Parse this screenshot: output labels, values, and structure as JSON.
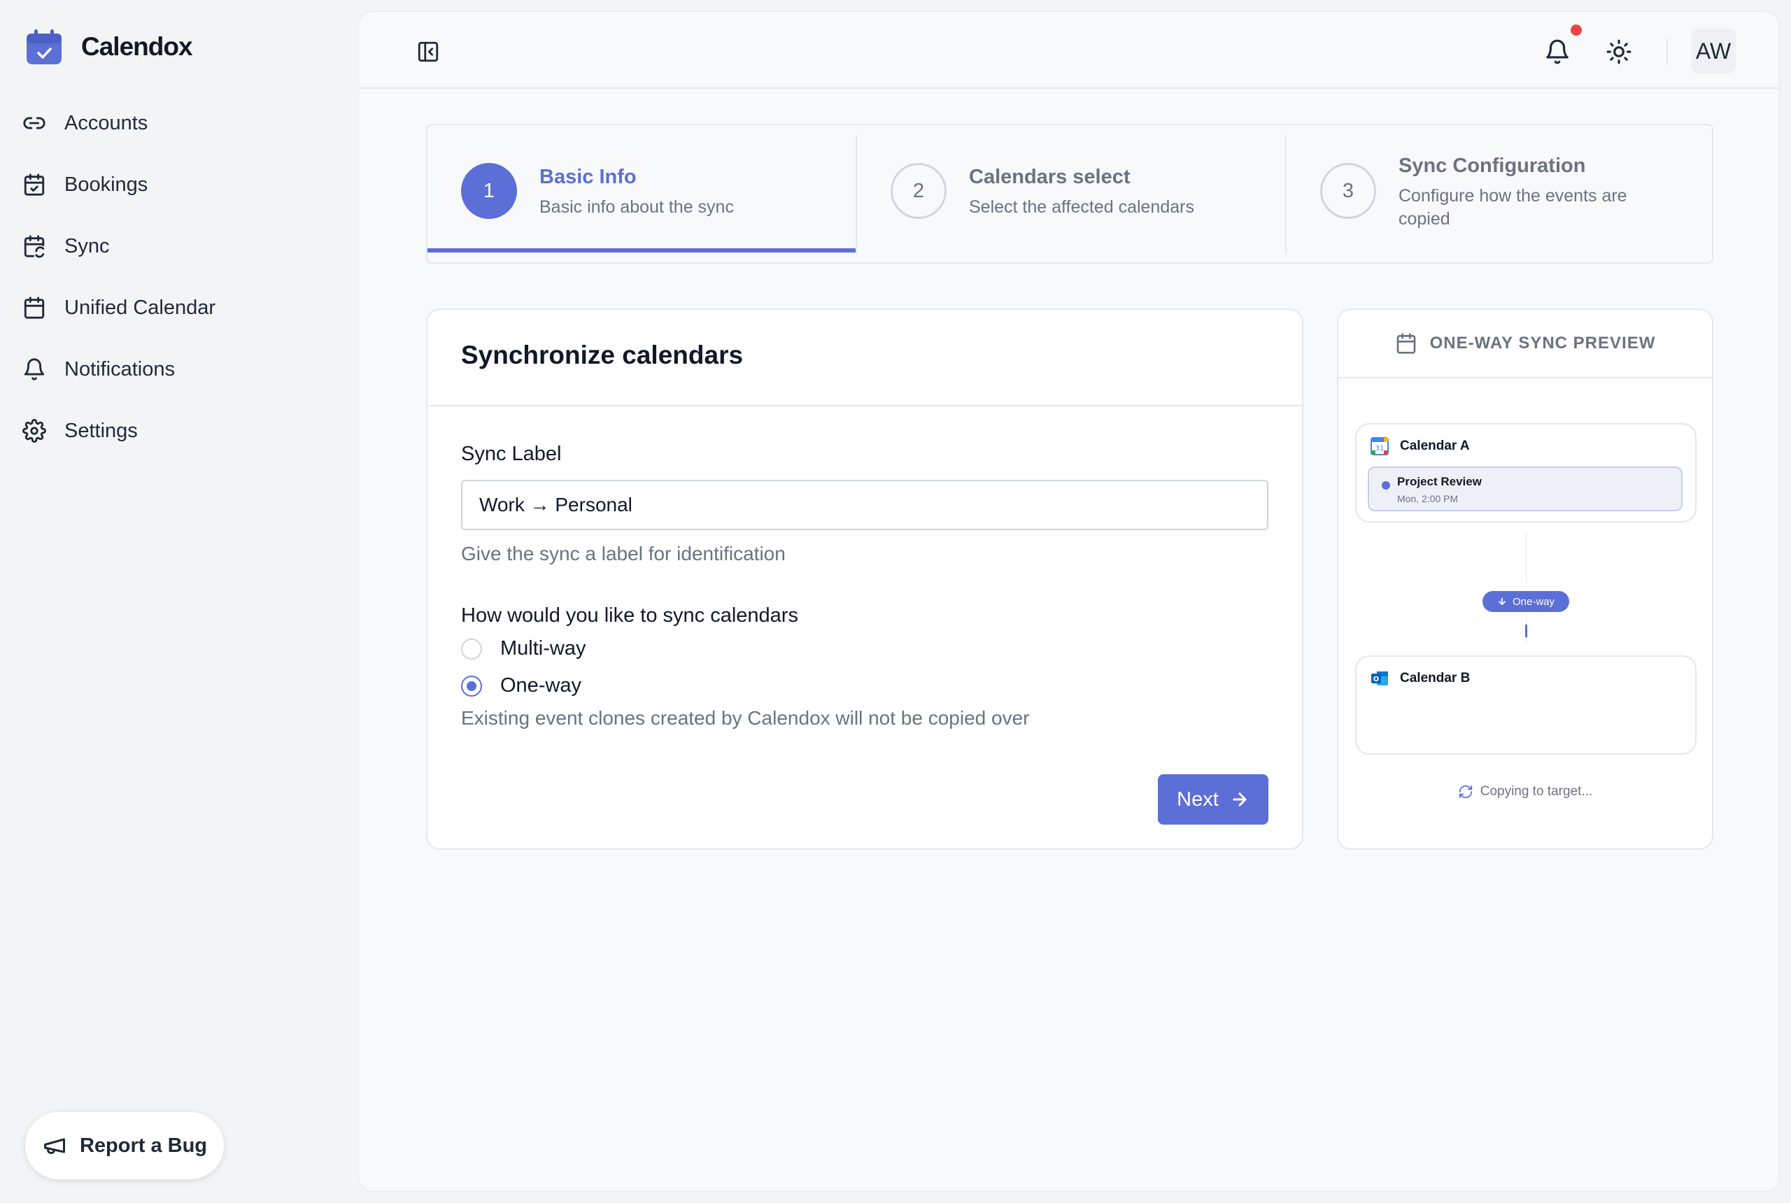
{
  "app": {
    "name": "Calendox"
  },
  "sidebar": {
    "items": [
      {
        "label": "Accounts",
        "icon": "link-icon"
      },
      {
        "label": "Bookings",
        "icon": "calendar-check-icon"
      },
      {
        "label": "Sync",
        "icon": "calendar-sync-icon"
      },
      {
        "label": "Unified Calendar",
        "icon": "calendar-icon"
      },
      {
        "label": "Notifications",
        "icon": "bell-icon"
      },
      {
        "label": "Settings",
        "icon": "gear-icon"
      }
    ],
    "report_bug": "Report a Bug"
  },
  "topbar": {
    "avatar_initials": "AW",
    "has_unread_notifications": true
  },
  "stepper": {
    "active_step": 1,
    "steps": [
      {
        "number": "1",
        "title": "Basic Info",
        "description": "Basic info about the sync"
      },
      {
        "number": "2",
        "title": "Calendars select",
        "description": "Select the affected calendars"
      },
      {
        "number": "3",
        "title": "Sync Configuration",
        "description": "Configure how the events are copied"
      }
    ]
  },
  "form": {
    "title": "Synchronize calendars",
    "sync_label": {
      "label": "Sync Label",
      "value": "Work → Personal",
      "hint": "Give the sync a label for identification"
    },
    "sync_mode": {
      "label": "How would you like to sync calendars",
      "options": [
        "Multi-way",
        "One-way"
      ],
      "selected": "One-way",
      "hint": "Existing event clones created by Calendox will not be copied over"
    },
    "next_label": "Next"
  },
  "preview": {
    "title": "ONE-WAY SYNC PREVIEW",
    "calendar_a": {
      "name": "Calendar A",
      "event_title": "Project Review",
      "event_time": "Mon, 2:00 PM"
    },
    "direction_label": "One-way",
    "calendar_b": {
      "name": "Calendar B"
    },
    "status": "Copying to target..."
  },
  "colors": {
    "accent": "#5b6fd6",
    "notification_dot": "#ef4444",
    "text_muted": "#6b7280",
    "border": "#e5e7eb"
  }
}
